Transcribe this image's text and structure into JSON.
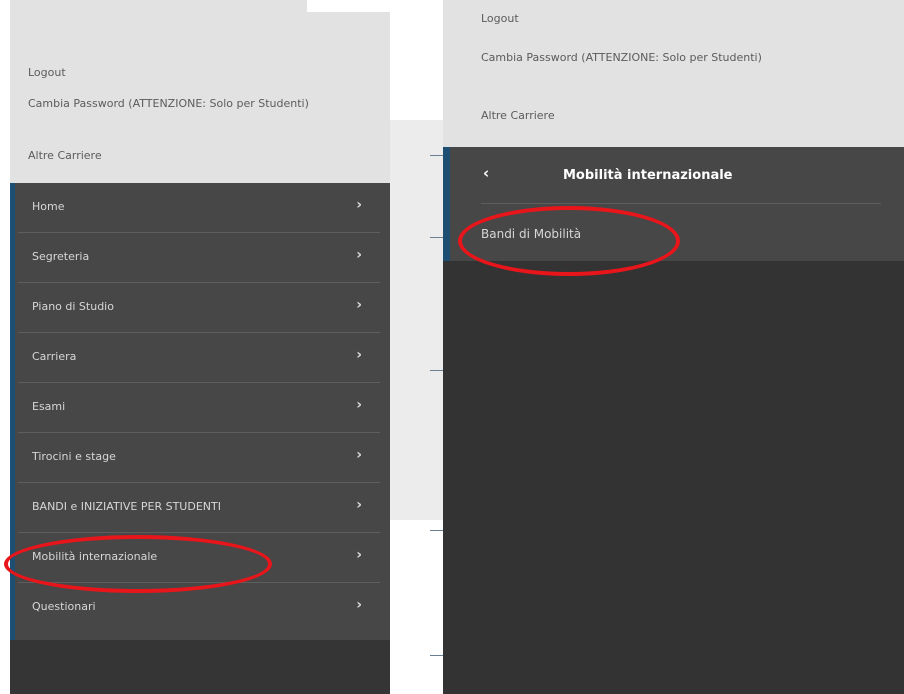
{
  "left_panel": {
    "account_links": [
      "Logout",
      "Cambia Password (ATTENZIONE: Solo per Studenti)",
      "Altre Carriere"
    ],
    "menu_items": [
      {
        "label": "Home",
        "icon": "chevron-right-icon"
      },
      {
        "label": "Segreteria",
        "icon": "chevron-right-icon"
      },
      {
        "label": "Piano di Studio",
        "icon": "chevron-right-icon"
      },
      {
        "label": "Carriera",
        "icon": "chevron-right-icon"
      },
      {
        "label": "Esami",
        "icon": "chevron-right-icon"
      },
      {
        "label": "Tirocini e stage",
        "icon": "chevron-right-icon"
      },
      {
        "label": "BANDI e INIZIATIVE PER STUDENTI",
        "icon": "chevron-right-icon"
      },
      {
        "label": "Mobilità internazionale",
        "icon": "chevron-right-icon",
        "highlighted": true
      },
      {
        "label": "Questionari",
        "icon": "chevron-right-icon"
      }
    ],
    "chevron_glyph": "›"
  },
  "right_panel": {
    "account_links": [
      "Logout",
      "Cambia Password (ATTENZIONE: Solo per Studenti)",
      "Altre Carriere"
    ],
    "submenu": {
      "back_glyph": "‹",
      "title": "Mobilità internazionale",
      "items": [
        {
          "label": "Bandi di Mobilità",
          "highlighted": true
        }
      ]
    }
  },
  "colors": {
    "annotation_red": "#e8151b",
    "menu_bg": "#474747",
    "accent_blue": "#1d4f73",
    "header_bg": "#e2e2e2"
  }
}
